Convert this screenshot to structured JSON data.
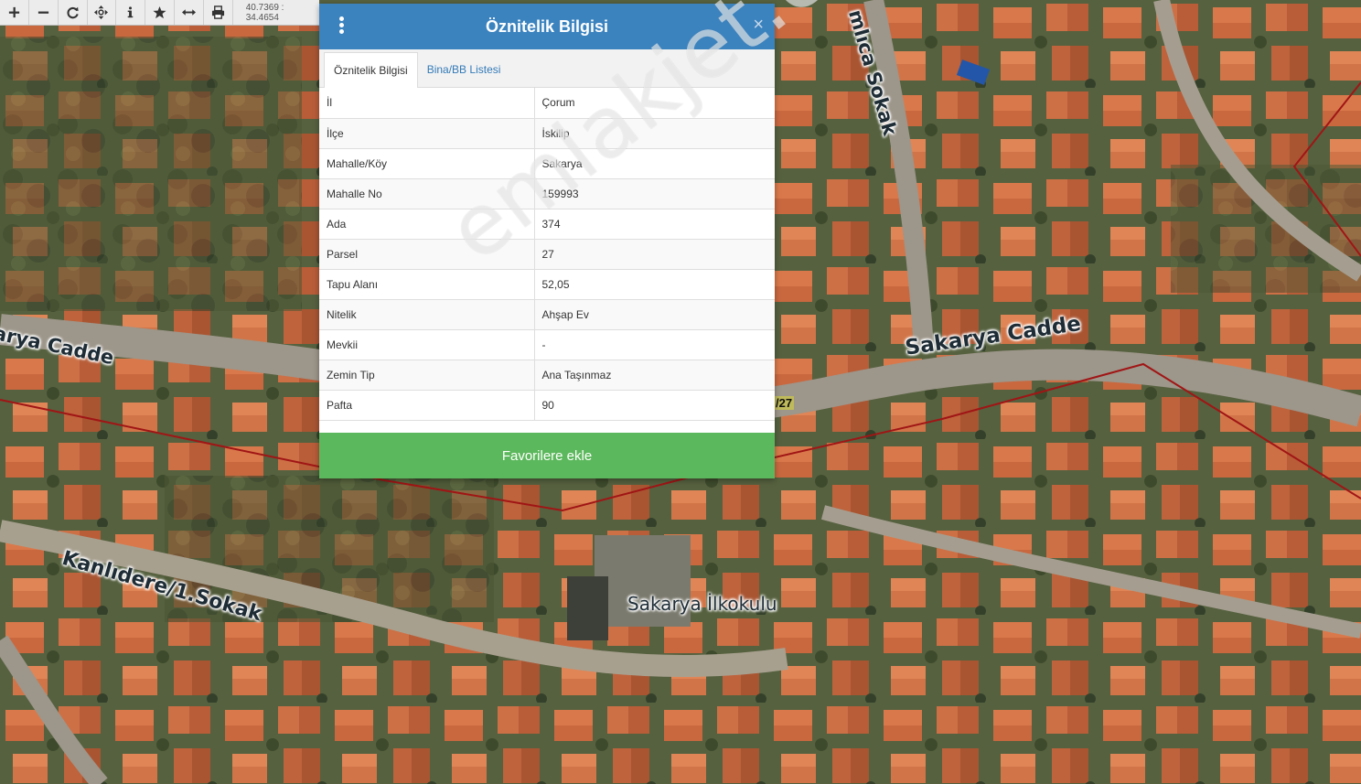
{
  "toolbar": {
    "tools": [
      "zoom-in-icon",
      "zoom-out-icon",
      "refresh-icon",
      "pan-icon",
      "info-icon",
      "favorite-star-icon",
      "measure-icon",
      "print-icon"
    ],
    "coordinates": "40.7369 : 34.4654"
  },
  "map": {
    "street_labels": {
      "kanlidere": "Kanlıdere/1.Sokak",
      "sakarya_right": "Sakarya Cadde",
      "sakarya_left": "arya Cadde",
      "sokak": "mlıca Sokak"
    },
    "school_label": "Sakarya İlkokulu",
    "parcel_tag": "/27",
    "parcel_line_color": "#a01515"
  },
  "modal": {
    "title": "Öznitelik Bilgisi",
    "close": "×",
    "tabs": [
      {
        "label": "Öznitelik Bilgisi",
        "active": true
      },
      {
        "label": "Bina/BB Listesi",
        "active": false
      }
    ],
    "rows": [
      {
        "key": "İl",
        "value": "Çorum"
      },
      {
        "key": "İlçe",
        "value": "İskilip"
      },
      {
        "key": "Mahalle/Köy",
        "value": "Sakarya"
      },
      {
        "key": "Mahalle No",
        "value": "159993"
      },
      {
        "key": "Ada",
        "value": "374"
      },
      {
        "key": "Parsel",
        "value": "27"
      },
      {
        "key": "Tapu Alanı",
        "value": "52,05"
      },
      {
        "key": "Nitelik",
        "value": "Ahşap Ev"
      },
      {
        "key": "Mevkii",
        "value": "-"
      },
      {
        "key": "Zemin Tip",
        "value": "Ana Taşınmaz"
      },
      {
        "key": "Pafta",
        "value": "90"
      }
    ],
    "favorite_button": "Favorilere ekle",
    "header_color": "#3b83bf",
    "button_color": "#5cb85c"
  },
  "watermark": "emlakjet.com"
}
